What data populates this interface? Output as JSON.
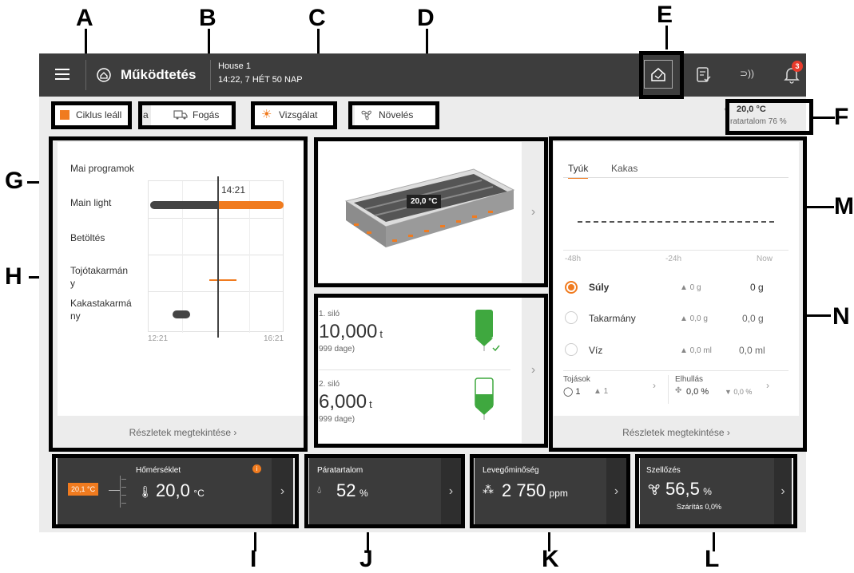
{
  "callouts": [
    "A",
    "B",
    "C",
    "D",
    "E",
    "F",
    "G",
    "H",
    "I",
    "J",
    "K",
    "L",
    "M",
    "N"
  ],
  "header": {
    "menu_icon": "hamburger-icon",
    "title": "Működtetés",
    "house": "House 1",
    "time": "14:22, 7 HÉT 50 NAP",
    "icons": [
      "home-icon",
      "checklist-icon",
      "signal-icon",
      "bell-icon"
    ],
    "bell_badge": "3"
  },
  "toolbar": {
    "cycle_stop": "Ciklus leáll",
    "cycle_extra": "a",
    "catch": "Fogás",
    "inspection": "Vizsgálat",
    "growth": "Növelés",
    "temp": "20,0 °C",
    "humidity": "ratartalom 76 %",
    "humidity_prefix": "‹"
  },
  "programs": {
    "title": "Mai programok",
    "rows": [
      "Main light",
      "Betöltés",
      "Tojótakarmán y",
      "Kakastakarmá ny"
    ],
    "now_label": "14:21",
    "axis_start": "12:21",
    "axis_end": "16:21",
    "details": "Részletek megtekintése"
  },
  "house_view": {
    "temp_label": "20,0 °C"
  },
  "silos": {
    "silo1_label": "1. siló",
    "silo1_value": "10,000",
    "silo1_unit": "t",
    "silo1_days": "999 dage)",
    "silo2_label": "2. siló",
    "silo2_value": "6,000",
    "silo2_unit": "t",
    "silo2_days": "999 dage)"
  },
  "animals": {
    "tabs": [
      "Tyúk",
      "Kakas"
    ],
    "axis": [
      "-48h",
      "-24h",
      "Now"
    ],
    "rows": [
      {
        "label": "Súly",
        "delta": "▲ 0 g",
        "value": "0 g"
      },
      {
        "label": "Takarmány",
        "delta": "▲ 0,0 g",
        "value": "0,0 g"
      },
      {
        "label": "Víz",
        "delta": "▲ 0,0 ml",
        "value": "0,0 ml"
      }
    ],
    "eggs_label": "Tojások",
    "eggs_value": "◯ 1",
    "eggs_delta": "▲ 1",
    "mortality_label": "Elhullás",
    "mortality_value": "0,0 %",
    "mortality_delta": "▼ 0,0 %",
    "details": "Részletek megtekintése"
  },
  "bottom": {
    "temp_title": "Hőmérséklet",
    "temp_badge": "20,1 °C",
    "temp_value": "20,0",
    "temp_unit": "°C",
    "hum_title": "Páratartalom",
    "hum_value": "52",
    "hum_unit": "%",
    "air_title": "Levegőminőség",
    "air_value": "2 750",
    "air_unit": "ppm",
    "vent_title": "Szellőzés",
    "vent_value": "56,5",
    "vent_unit": "%",
    "vent_sub": "Szárítás 0,0%"
  },
  "colors": {
    "accent": "#f07b1f",
    "dark": "#3b3b3b",
    "green": "#3fa83f"
  }
}
